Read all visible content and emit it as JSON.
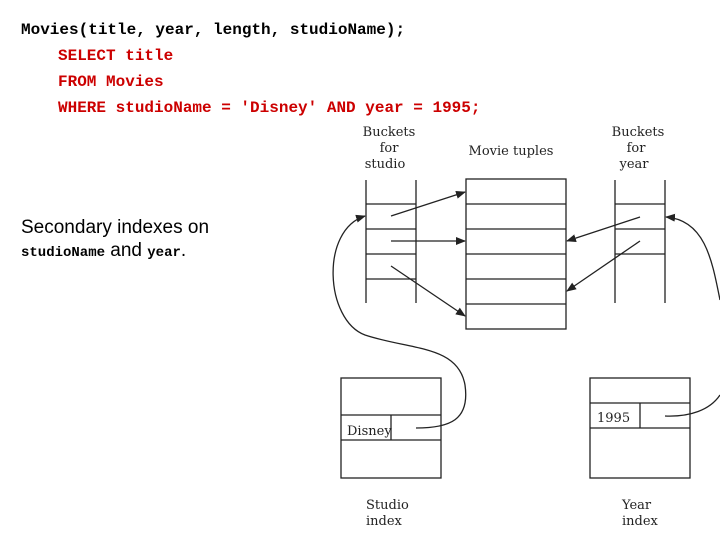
{
  "code": {
    "schema": "Movies(title, year, length, studioName);",
    "query_lines": [
      "SELECT title",
      "FROM Movies",
      "WHERE studioName = 'Disney' AND year = 1995;"
    ]
  },
  "caption": {
    "line1": "Secondary indexes on",
    "field1": "studioName",
    "conj": " and ",
    "field2": "year",
    "end": "."
  },
  "diagram": {
    "studio_buckets_label": [
      "Buckets",
      "for",
      "studio"
    ],
    "movie_tuples_label": "Movie tuples",
    "year_buckets_label": [
      "Buckets",
      "for",
      "year"
    ],
    "studio_index_key": "Disney",
    "year_index_key": "1995",
    "studio_index_label": [
      "Studio",
      "index"
    ],
    "year_index_label": [
      "Year",
      "index"
    ]
  },
  "colors": {
    "query_text": "#cc0000",
    "schema_text": "#000000",
    "diagram_lines": "#222222"
  }
}
